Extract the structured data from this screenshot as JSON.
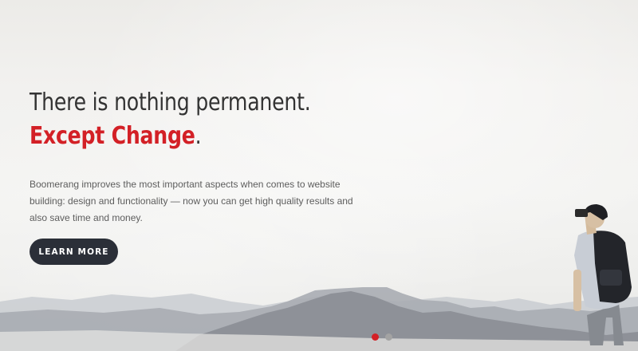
{
  "hero": {
    "headline_line1": "There is nothing permanent.",
    "headline_accent": "Except Change",
    "headline_punct": ".",
    "description": "Boomerang improves the most important aspects when comes to website building: design and functionality — now you can get high quality results and also save time and money.",
    "cta_label": "LEARN MORE"
  },
  "slider": {
    "slide_count": 2,
    "active_index": 0
  },
  "colors": {
    "accent": "#d32026",
    "button": "#2b2f38",
    "heading": "#333333",
    "body_text": "#5d5d5d"
  }
}
